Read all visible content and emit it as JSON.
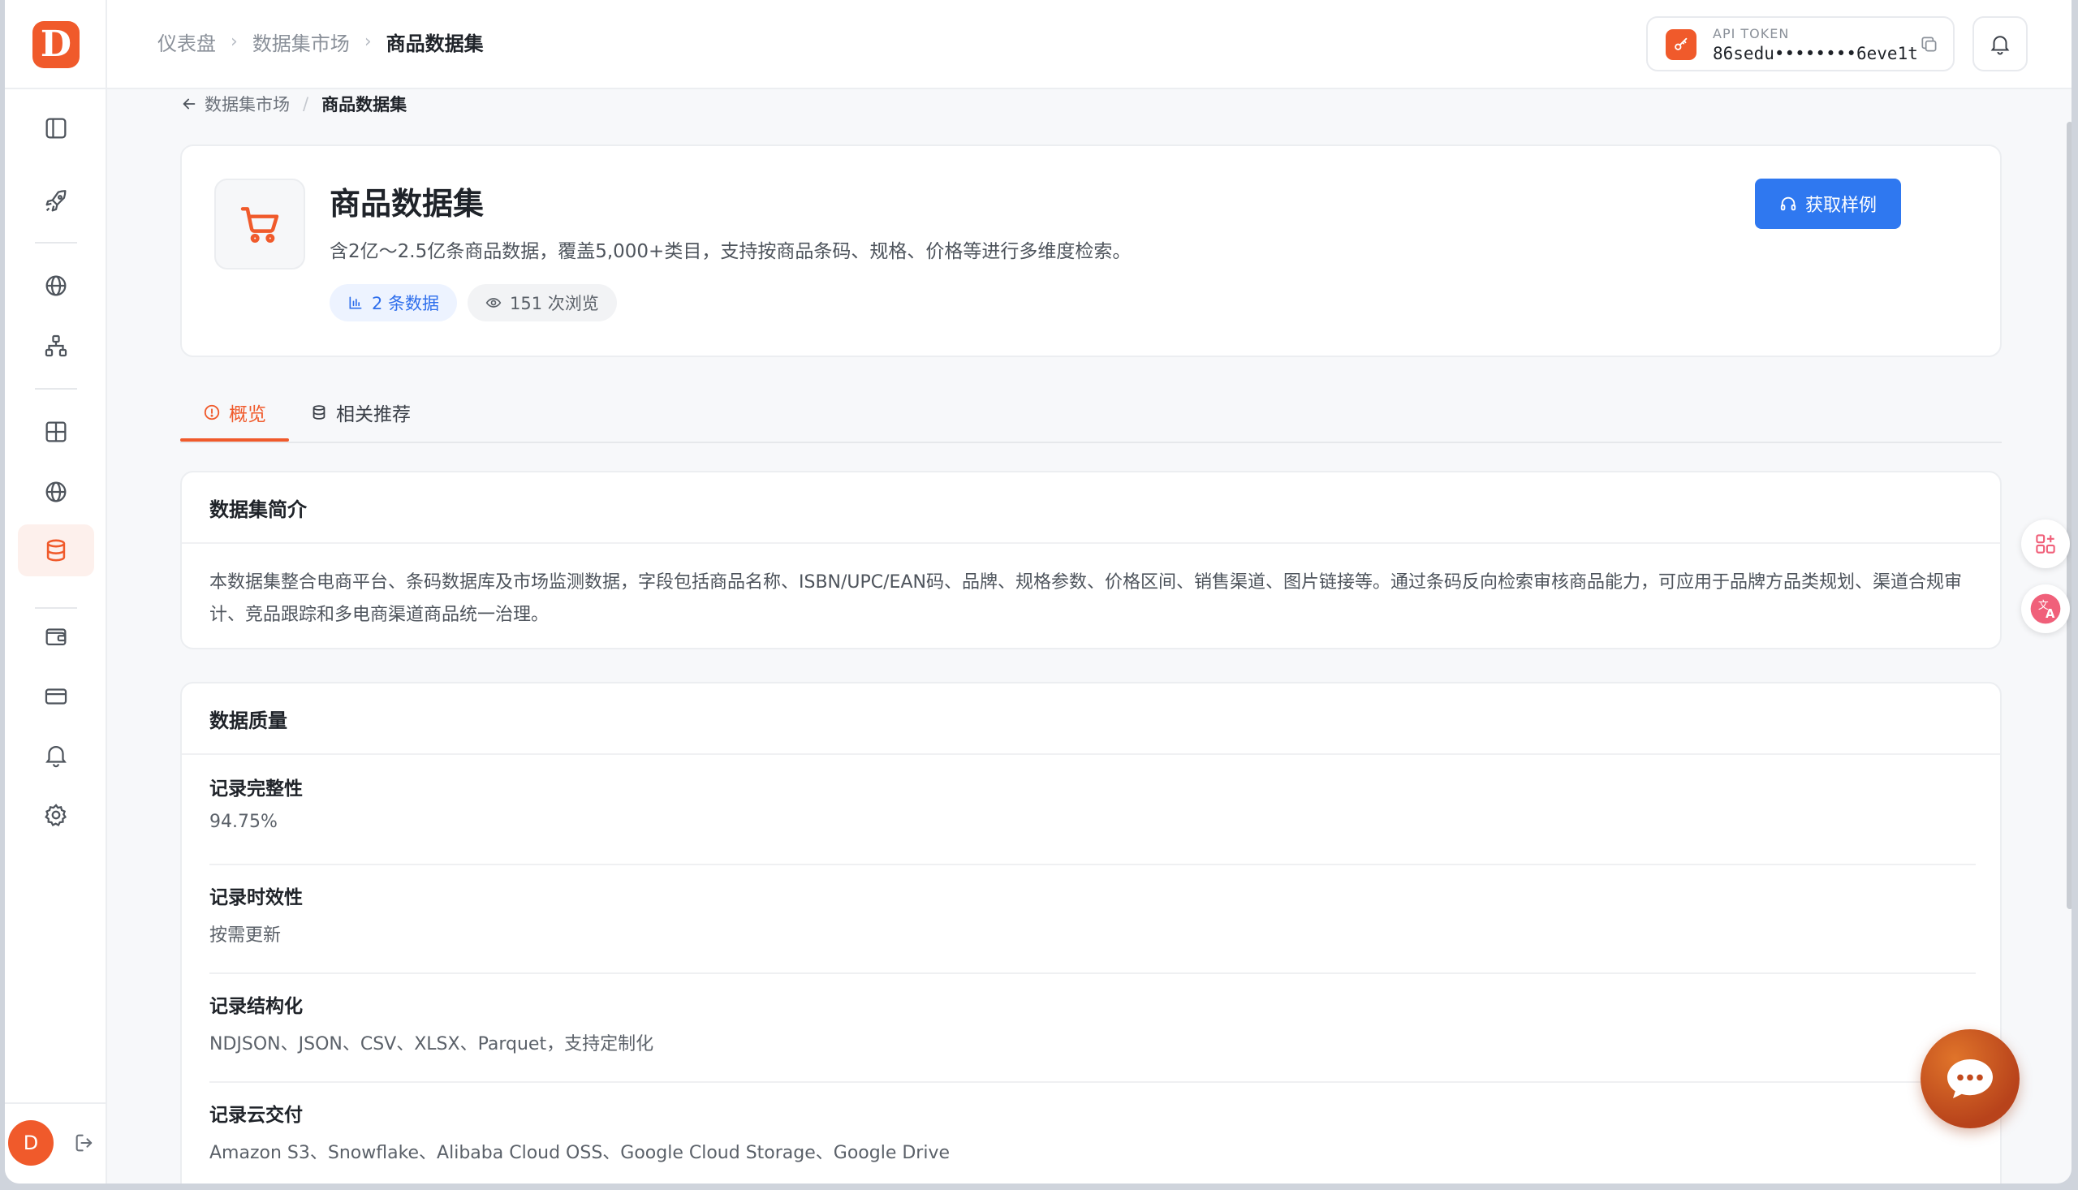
{
  "header": {
    "breadcrumbs": [
      "仪表盘",
      "数据集市场",
      "商品数据集"
    ],
    "token_label": "API TOKEN",
    "token_value": "86sedu••••••••6eve1t"
  },
  "sub_crumb": {
    "parent": "数据集市场",
    "current": "商品数据集"
  },
  "dataset": {
    "title": "商品数据集",
    "description": "含2亿～2.5亿条商品数据，覆盖5,000+类目，支持按商品条码、规格、价格等进行多维度检索。",
    "records_chip": "2 条数据",
    "views_chip": "151 次浏览",
    "sample_button": "获取样例"
  },
  "tabs": [
    {
      "label": "概览"
    },
    {
      "label": "相关推荐"
    }
  ],
  "intro": {
    "title": "数据集简介",
    "text": "本数据集整合电商平台、条码数据库及市场监测数据，字段包括商品名称、ISBN/UPC/EAN码、品牌、规格参数、价格区间、销售渠道、图片链接等。通过条码反向检索审核商品能力，可应用于品牌方品类规划、渠道合规审计、竞品跟踪和多电商渠道商品统一治理。"
  },
  "quality": {
    "title": "数据质量",
    "rows": [
      {
        "label": "记录完整性",
        "value": "94.75%"
      },
      {
        "label": "记录时效性",
        "value": "按需更新"
      },
      {
        "label": "记录结构化",
        "value": "NDJSON、JSON、CSV、XLSX、Parquet，支持定制化"
      },
      {
        "label": "记录云交付",
        "value": "Amazon S3、Snowflake、Alibaba Cloud OSS、Google Cloud Storage、Google Drive"
      }
    ]
  },
  "user": {
    "avatar_initial": "D"
  },
  "colors": {
    "accent": "#f05a2b",
    "primary_button": "#2f78f0",
    "chip_blue": "#2f6fec"
  },
  "icons": {
    "logo": "D",
    "sidebar": [
      "sidebar-toggle-icon",
      "rocket-icon",
      "globe-icon",
      "sitemap-icon",
      "grid-icon",
      "globe-icon",
      "database-icon",
      "wallet-icon",
      "credit-card-icon",
      "bell-icon",
      "gear-icon"
    ]
  }
}
